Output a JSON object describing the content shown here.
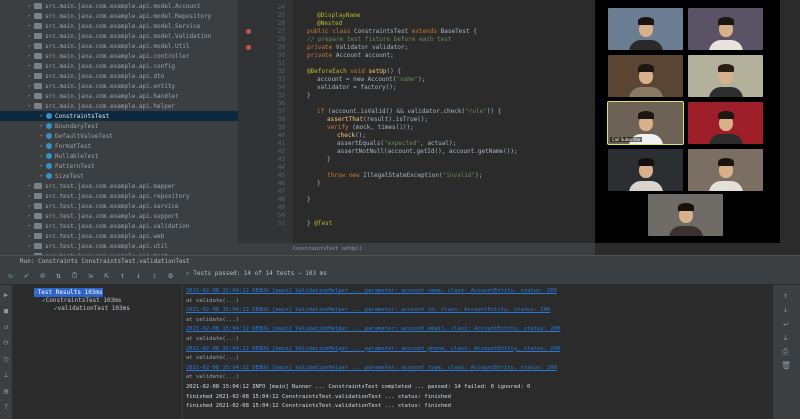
{
  "project_tree": {
    "selected_index": 11,
    "rows": [
      {
        "label": "src.main.java.com.example.api.model.Account",
        "indent": 28,
        "type": "folder"
      },
      {
        "label": "src.main.java.com.example.api.model.Repository",
        "indent": 28,
        "type": "folder"
      },
      {
        "label": "src.main.java.com.example.api.model.Service",
        "indent": 28,
        "type": "folder"
      },
      {
        "label": "src.main.java.com.example.api.model.Validation",
        "indent": 28,
        "type": "folder"
      },
      {
        "label": "src.main.java.com.example.api.model.Util",
        "indent": 28,
        "type": "folder"
      },
      {
        "label": "src.main.java.com.example.api.controller",
        "indent": 28,
        "type": "folder"
      },
      {
        "label": "src.main.java.com.example.api.config",
        "indent": 28,
        "type": "folder"
      },
      {
        "label": "src.main.java.com.example.api.dto",
        "indent": 28,
        "type": "folder"
      },
      {
        "label": "src.main.java.com.example.api.entity",
        "indent": 28,
        "type": "folder"
      },
      {
        "label": "src.main.java.com.example.api.handler",
        "indent": 28,
        "type": "folder"
      },
      {
        "label": "src.main.java.com.example.api.helper",
        "indent": 28,
        "type": "folder"
      },
      {
        "label": "ConstraintsTest",
        "indent": 40,
        "type": "class"
      },
      {
        "label": "BoundaryTest",
        "indent": 40,
        "type": "class"
      },
      {
        "label": "DefaultValueTest",
        "indent": 40,
        "type": "class"
      },
      {
        "label": "FormatTest",
        "indent": 40,
        "type": "class"
      },
      {
        "label": "NullableTest",
        "indent": 40,
        "type": "class"
      },
      {
        "label": "PatternTest",
        "indent": 40,
        "type": "class"
      },
      {
        "label": "SizeTest",
        "indent": 40,
        "type": "class"
      },
      {
        "label": "src.test.java.com.example.api.mapper",
        "indent": 28,
        "type": "folder"
      },
      {
        "label": "src.test.java.com.example.api.repository",
        "indent": 28,
        "type": "folder"
      },
      {
        "label": "src.test.java.com.example.api.service",
        "indent": 28,
        "type": "folder"
      },
      {
        "label": "src.test.java.com.example.api.support",
        "indent": 28,
        "type": "folder"
      },
      {
        "label": "src.test.java.com.example.api.validation",
        "indent": 28,
        "type": "folder"
      },
      {
        "label": "src.test.java.com.example.api.web",
        "indent": 28,
        "type": "folder"
      },
      {
        "label": "src.test.java.com.example.api.util",
        "indent": 28,
        "type": "folder"
      },
      {
        "label": "src.test.java.com.example.api.test",
        "indent": 28,
        "type": "folder"
      }
    ]
  },
  "editor": {
    "line_numbers": [
      "24",
      "25",
      "26",
      "27",
      "28",
      "29",
      "30",
      "31",
      "32",
      "33",
      "34",
      "35",
      "36",
      "37",
      "38",
      "39",
      "40",
      "41",
      "42",
      "43",
      "44",
      "45",
      "46",
      "47",
      "48",
      "49",
      "50",
      "51"
    ],
    "breakpoint_rows": [
      3,
      5
    ],
    "lines": [
      {
        "indent": 0,
        "tokens": [
          {
            "t": "",
            "c": "pl"
          }
        ]
      },
      {
        "indent": 20,
        "tokens": [
          {
            "t": "@DisplayName",
            "c": "an"
          }
        ]
      },
      {
        "indent": 20,
        "tokens": [
          {
            "t": "@Nested",
            "c": "an"
          }
        ]
      },
      {
        "indent": 10,
        "tokens": [
          {
            "t": "public ",
            "c": "kw"
          },
          {
            "t": "class ",
            "c": "kw"
          },
          {
            "t": "ConstraintsTest ",
            "c": "pl"
          },
          {
            "t": "extends ",
            "c": "kw"
          },
          {
            "t": "BaseTest {",
            "c": "pl"
          }
        ]
      },
      {
        "indent": 10,
        "tokens": [
          {
            "t": "  // prepare test fixture before each test",
            "c": "str"
          }
        ]
      },
      {
        "indent": 10,
        "tokens": [
          {
            "t": "  private ",
            "c": "kw"
          },
          {
            "t": "Validator validator;",
            "c": "pl"
          }
        ]
      },
      {
        "indent": 10,
        "tokens": [
          {
            "t": "  private ",
            "c": "kw"
          },
          {
            "t": "Account account;",
            "c": "pl"
          }
        ]
      },
      {
        "indent": 10,
        "tokens": [
          {
            "t": "",
            "c": "pl"
          }
        ]
      },
      {
        "indent": 10,
        "tokens": [
          {
            "t": "  @BeforeEach ",
            "c": "an"
          },
          {
            "t": "void ",
            "c": "kw"
          },
          {
            "t": "setUp",
            "c": "fn"
          },
          {
            "t": "() {",
            "c": "pl"
          }
        ]
      },
      {
        "indent": 20,
        "tokens": [
          {
            "t": "account = new Account(",
            "c": "pl"
          },
          {
            "t": "\"name\"",
            "c": "str"
          },
          {
            "t": ");",
            "c": "pl"
          }
        ]
      },
      {
        "indent": 20,
        "tokens": [
          {
            "t": "validator = factory();",
            "c": "pl"
          }
        ]
      },
      {
        "indent": 10,
        "tokens": [
          {
            "t": "  }",
            "c": "pl"
          }
        ]
      },
      {
        "indent": 10,
        "tokens": [
          {
            "t": "",
            "c": "pl"
          }
        ]
      },
      {
        "indent": 20,
        "tokens": [
          {
            "t": "if ",
            "c": "kw"
          },
          {
            "t": "(account.isValid() && validator.check(",
            "c": "pl"
          },
          {
            "t": "\"rule\"",
            "c": "str"
          },
          {
            "t": ")) {",
            "c": "pl"
          }
        ]
      },
      {
        "indent": 30,
        "tokens": [
          {
            "t": "assertThat",
            "c": "fn"
          },
          {
            "t": "(result).isTrue();",
            "c": "pl"
          }
        ]
      },
      {
        "indent": 30,
        "tokens": [
          {
            "t": "verify ",
            "c": "kw"
          },
          {
            "t": "(mock, times(",
            "c": "pl"
          },
          {
            "t": "1",
            "c": "num"
          },
          {
            "t": "));",
            "c": "pl"
          }
        ]
      },
      {
        "indent": 40,
        "tokens": [
          {
            "t": "check",
            "c": "fn"
          },
          {
            "t": "();",
            "c": "pl"
          }
        ]
      },
      {
        "indent": 40,
        "tokens": [
          {
            "t": "assertEquals(",
            "c": "pl"
          },
          {
            "t": "\"expected\"",
            "c": "str"
          },
          {
            "t": ", actual);",
            "c": "pl"
          }
        ]
      },
      {
        "indent": 40,
        "tokens": [
          {
            "t": "assertNotNull(account.getId(), account.getName());",
            "c": "pl"
          }
        ]
      },
      {
        "indent": 30,
        "tokens": [
          {
            "t": "}",
            "c": "pl"
          }
        ]
      },
      {
        "indent": 20,
        "tokens": [
          {
            "t": "",
            "c": "pl"
          }
        ]
      },
      {
        "indent": 30,
        "tokens": [
          {
            "t": "throw ",
            "c": "kw"
          },
          {
            "t": "new ",
            "c": "kw"
          },
          {
            "t": "IllegalStateException(",
            "c": "pl"
          },
          {
            "t": "\"invalid\"",
            "c": "str"
          },
          {
            "t": ");",
            "c": "pl"
          }
        ]
      },
      {
        "indent": 20,
        "tokens": [
          {
            "t": "}",
            "c": "pl"
          }
        ]
      },
      {
        "indent": 10,
        "tokens": [
          {
            "t": "",
            "c": "pl"
          }
        ]
      },
      {
        "indent": 10,
        "tokens": [
          {
            "t": "  }",
            "c": "pl"
          }
        ]
      },
      {
        "indent": 0,
        "tokens": [
          {
            "t": "",
            "c": "pl"
          }
        ]
      },
      {
        "indent": 0,
        "tokens": [
          {
            "t": "",
            "c": "pl"
          }
        ]
      },
      {
        "indent": 10,
        "tokens": [
          {
            "t": "  }  ",
            "c": "pl"
          },
          {
            "t": "@Test ",
            "c": "an"
          }
        ]
      }
    ]
  },
  "status_line": "ConstraintsTest    setUp()",
  "video": {
    "active_tile_name": "Call Subscribe",
    "tiles": [
      {
        "bg": "#6a7d93",
        "shirt": "#2a2a2a",
        "hair": "#1a1410"
      },
      {
        "bg": "#5a5366",
        "shirt": "#e8e4dd",
        "hair": "#1b1612"
      },
      {
        "bg": "#5a4534",
        "shirt": "#8a7a64",
        "hair": "#1d1613"
      },
      {
        "bg": "#b3b19c",
        "shirt": "#2e2e2e",
        "hair": "#2a1f18"
      },
      {
        "bg": "#6e6256",
        "shirt": "#f0f0f0",
        "hair": "#1e1612"
      },
      {
        "bg": "#9e1f2a",
        "shirt": "#2c2c2c",
        "hair": "#211813"
      },
      {
        "bg": "#2b2f34",
        "shirt": "#d9d4cf",
        "hair": "#141010"
      },
      {
        "bg": "#7b6e62",
        "shirt": "#e3dfd9",
        "hair": "#1c1511"
      },
      {
        "bg": "#6f6c67",
        "shirt": "#3a3230",
        "hair": "#17110e"
      }
    ]
  },
  "run_panel": {
    "header": "Run:   Constraints   ConstraintsTest.validationTest",
    "summary": "Tests passed: 14 of 14 tests – 103 ms",
    "tree_rows": [
      {
        "label": "Test Results  103ms",
        "indent": 22,
        "selected": true
      },
      {
        "label": "ConstraintsTest  103ms",
        "indent": 30,
        "selected": false
      },
      {
        "label": "validationTest  103ms",
        "indent": 42,
        "selected": false
      }
    ],
    "console_lines": [
      {
        "text": "2021-02-08 15:04:12 DEBUG [main] ValidationHelper ... parameter: account_name, class: AccountEntity, status: 200",
        "type": "link"
      },
      {
        "text": "  at validate(...)",
        "type": "grey"
      },
      {
        "text": "2021-02-08 15:04:12 DEBUG [main] ValidationHelper ... parameter: account_id, class: AccountEntity, status: 200",
        "type": "link"
      },
      {
        "text": "  at validate(...)",
        "type": "grey"
      },
      {
        "text": "2021-02-08 15:04:12 DEBUG [main] ValidationHelper ... parameter: account_email, class: AccountEntity, status: 200",
        "type": "link"
      },
      {
        "text": "  at validate(...)",
        "type": "grey"
      },
      {
        "text": "2021-02-08 15:04:12 DEBUG [main] ValidationHelper ... parameter: account_phone, class: AccountEntity, status: 200",
        "type": "link"
      },
      {
        "text": "  at validate(...)",
        "type": "grey"
      },
      {
        "text": "2021-02-08 15:04:12 DEBUG [main] ValidationHelper ... parameter: account_type, class: AccountEntity, status: 200",
        "type": "link"
      },
      {
        "text": "  at validate(...)",
        "type": "grey"
      },
      {
        "text": "2021-02-08 15:04:12 INFO  [main] Runner ... ConstraintsTest completed               ... passed: 14  failed: 0  ignored: 0",
        "type": "white"
      },
      {
        "text": "  finished 2021-02-08 15:04:12         ConstraintsTest.validationTest          ... status: finished",
        "type": "white"
      },
      {
        "text": "  finished 2021-02-08 15:04:12         ConstraintsTest.validationTest          ... status: finished",
        "type": "white"
      }
    ]
  },
  "colors": {
    "accent": "#287bde",
    "pass": "#59a869",
    "selection": "#0d293e"
  }
}
